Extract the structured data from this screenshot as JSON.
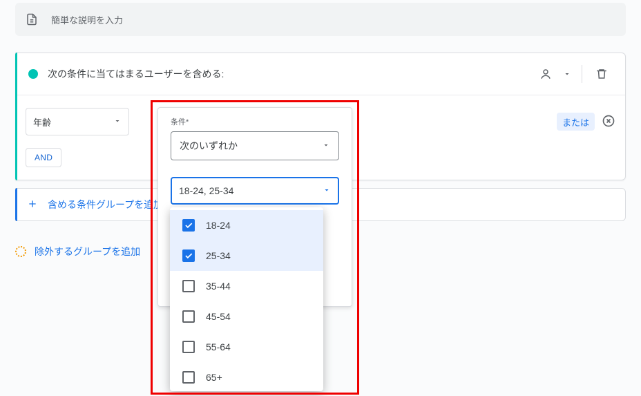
{
  "description_placeholder": "簡単な説明を入力",
  "group": {
    "title": "次の条件に当てはまるユーザーを含める:",
    "dimension_label": "年齢",
    "or_label": "または",
    "and_label": "AND"
  },
  "add_condition_group": "含める条件グループを追加",
  "exclude_group": "除外するグループを追加",
  "popover": {
    "condition_label": "条件*",
    "condition_value": "次のいずれか",
    "value_display": "18-24, 25-34",
    "options": [
      {
        "label": "18-24",
        "checked": true
      },
      {
        "label": "25-34",
        "checked": true
      },
      {
        "label": "35-44",
        "checked": false
      },
      {
        "label": "45-54",
        "checked": false
      },
      {
        "label": "55-64",
        "checked": false
      },
      {
        "label": "65+",
        "checked": false
      }
    ]
  }
}
